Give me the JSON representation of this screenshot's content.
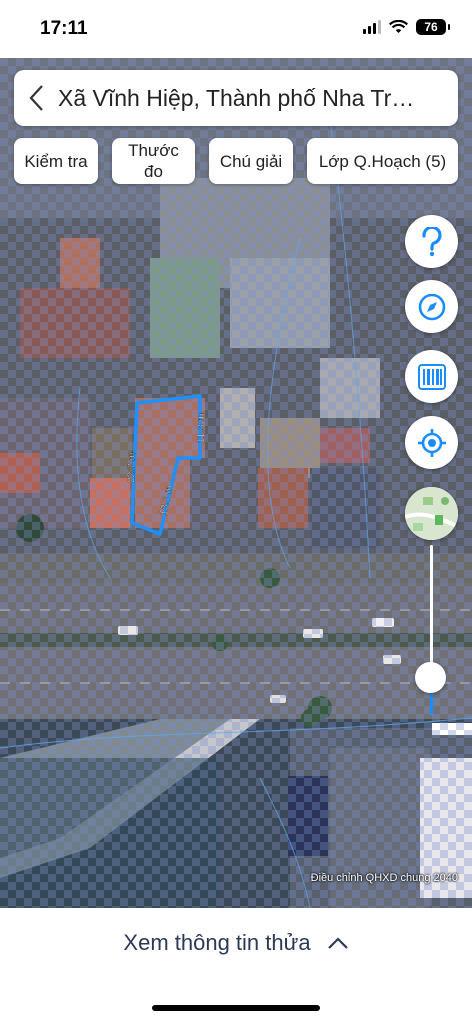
{
  "status_bar": {
    "time": "17:11",
    "battery": "76"
  },
  "search": {
    "title": "Xã Vĩnh Hiệp, Thành phố Nha Tr…"
  },
  "chips": {
    "kiemtra": "Kiểm tra",
    "thuoc_line1": "Thước",
    "thuoc_line2": "đo",
    "chugiai": "Chú giải",
    "lop": "Lớp Q.Hoạch (5)"
  },
  "parcel": {
    "edges": [
      "22.7 m",
      "11.3 m",
      "13.7 m"
    ],
    "outline_color": "#1e90ff"
  },
  "tools": [
    "help-icon",
    "compass-icon",
    "barcode-icon",
    "locate-icon",
    "layer-thumbnail-icon"
  ],
  "opacity_slider": {
    "value_fraction": 0.2
  },
  "map_caption": "Điều chỉnh QHXD chung 2040",
  "bottom_sheet": {
    "title": "Xem thông tin thửa"
  },
  "colors": {
    "accent": "#1a8cff",
    "sheet_text": "#2c3a55"
  }
}
